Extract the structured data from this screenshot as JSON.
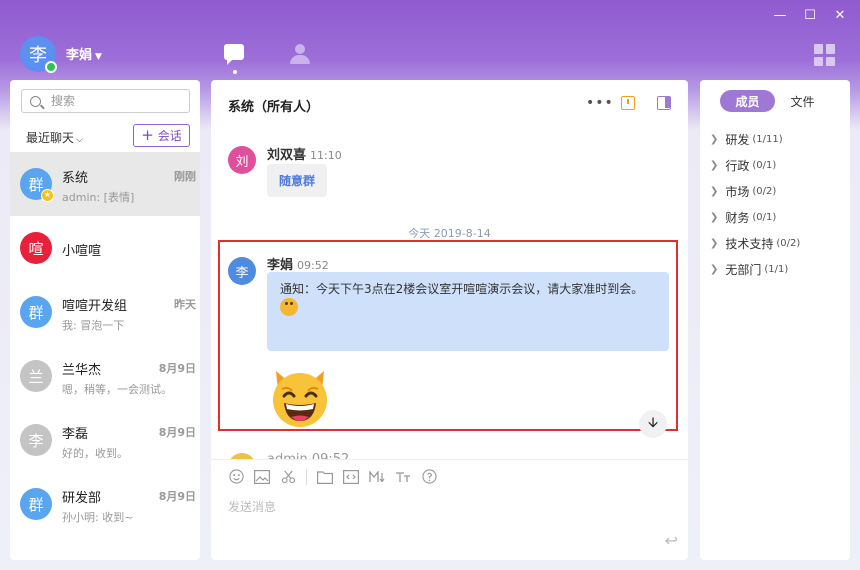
{
  "window": {
    "min": "—",
    "max": "☐",
    "close": "✕"
  },
  "user": {
    "avatar_text": "李",
    "name": "李娟",
    "status_color": "#2fc25b"
  },
  "left": {
    "search_placeholder": "搜索",
    "recent_label": "最近聊天",
    "new_chat_label": "会话",
    "chats": [
      {
        "avatar": "群",
        "color": "#5aa5f0",
        "name": "系统",
        "time": "刚刚",
        "preview": "admin: [表情]",
        "starred": true
      },
      {
        "avatar": "喧",
        "color": "#e8203a",
        "name": "小喧喧",
        "time": "",
        "preview": ""
      },
      {
        "avatar": "群",
        "color": "#5aa5f0",
        "name": "喧喧开发组",
        "time": "昨天",
        "preview": "我: 冒泡一下"
      },
      {
        "avatar": "兰",
        "color": "#c4c4c4",
        "name": "兰华杰",
        "time": "8月9日",
        "preview": "嗯，稍等，一会测试。"
      },
      {
        "avatar": "李",
        "color": "#c4c4c4",
        "name": "李磊",
        "time": "8月9日",
        "preview": "好的，收到。"
      },
      {
        "avatar": "群",
        "color": "#5aa5f0",
        "name": "研发部",
        "time": "8月9日",
        "preview": "孙小明: 收到~"
      }
    ]
  },
  "main": {
    "title": "系统（所有人）",
    "more": "•••",
    "messages": [
      {
        "avatar": "刘",
        "color": "#e0509a",
        "sender": "刘双喜",
        "time": "11:10",
        "text": "随意群"
      },
      {
        "avatar": "李",
        "color": "#4f8be0",
        "sender": "李娟",
        "time": "09:52",
        "text": "通知：今天下午3点在2楼会议室开喧喧演示会议，请大家准时到会。"
      }
    ],
    "date_separator": "今天 2019-8-14",
    "partial_sender": "admin 09:52",
    "input_placeholder": "发送消息",
    "send_icon": "↩"
  },
  "right": {
    "tabs": [
      "成员",
      "文件"
    ],
    "departments": [
      {
        "name": "研发",
        "count": "(1/11)"
      },
      {
        "name": "行政",
        "count": "(0/1)"
      },
      {
        "name": "市场",
        "count": "(0/2)"
      },
      {
        "name": "财务",
        "count": "(0/1)"
      },
      {
        "name": "技术支持",
        "count": "(0/2)"
      },
      {
        "name": "无部门",
        "count": "(1/1)"
      }
    ]
  }
}
